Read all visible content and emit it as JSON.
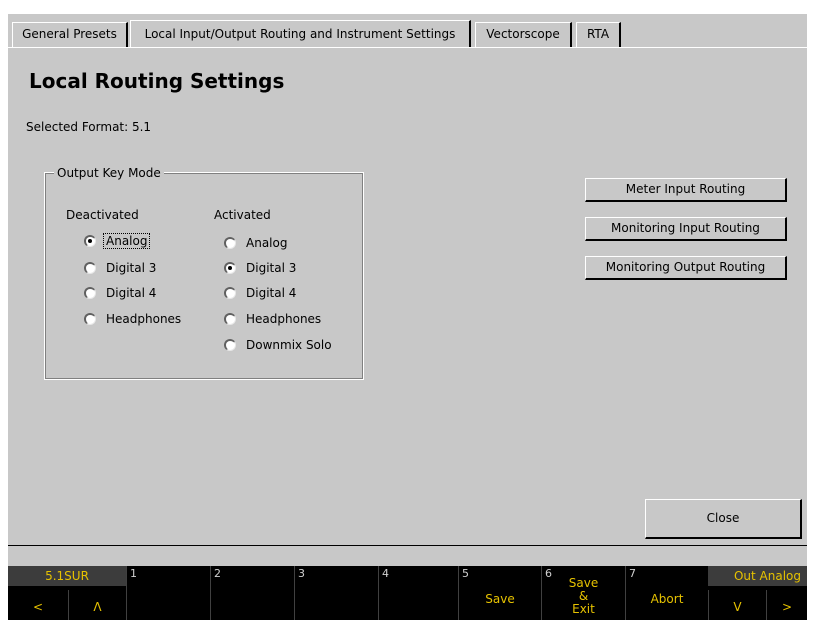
{
  "tabs": [
    {
      "label": "General Presets"
    },
    {
      "label": "Local Input/Output Routing and Instrument Settings"
    },
    {
      "label": "Vectorscope"
    },
    {
      "label": "RTA"
    }
  ],
  "page": {
    "title": "Local Routing Settings",
    "selected_format": "Selected Format: 5.1"
  },
  "output_key_mode": {
    "legend": "Output Key Mode",
    "deactivated_header": "Deactivated",
    "activated_header": "Activated",
    "deactivated_options": [
      "Analog",
      "Digital 3",
      "Digital 4",
      "Headphones"
    ],
    "deactivated_selected": "Analog",
    "activated_options": [
      "Analog",
      "Digital 3",
      "Digital 4",
      "Headphones",
      "Downmix Solo"
    ],
    "activated_selected": "Digital 3"
  },
  "routing_buttons": {
    "meter_input": "Meter Input Routing",
    "monitoring_input": "Monitoring Input Routing",
    "monitoring_output": "Monitoring Output Routing"
  },
  "close_label": "Close",
  "softkeys": {
    "left_head": "5.1SUR",
    "left_prev": "<",
    "left_up": "Λ",
    "keys": [
      {
        "num": "1",
        "label": ""
      },
      {
        "num": "2",
        "label": ""
      },
      {
        "num": "3",
        "label": ""
      },
      {
        "num": "4",
        "label": ""
      },
      {
        "num": "5",
        "label": "Save"
      },
      {
        "num": "6",
        "label_lines": [
          "Save",
          "&",
          "Exit"
        ]
      },
      {
        "num": "7",
        "label": "Abort"
      }
    ],
    "right_head": "Out Analog",
    "right_down": "V",
    "right_next": ">"
  },
  "colors": {
    "panel": "#c8c8c8",
    "softkey_text": "#e6c200",
    "softkey_bg": "#000000"
  }
}
